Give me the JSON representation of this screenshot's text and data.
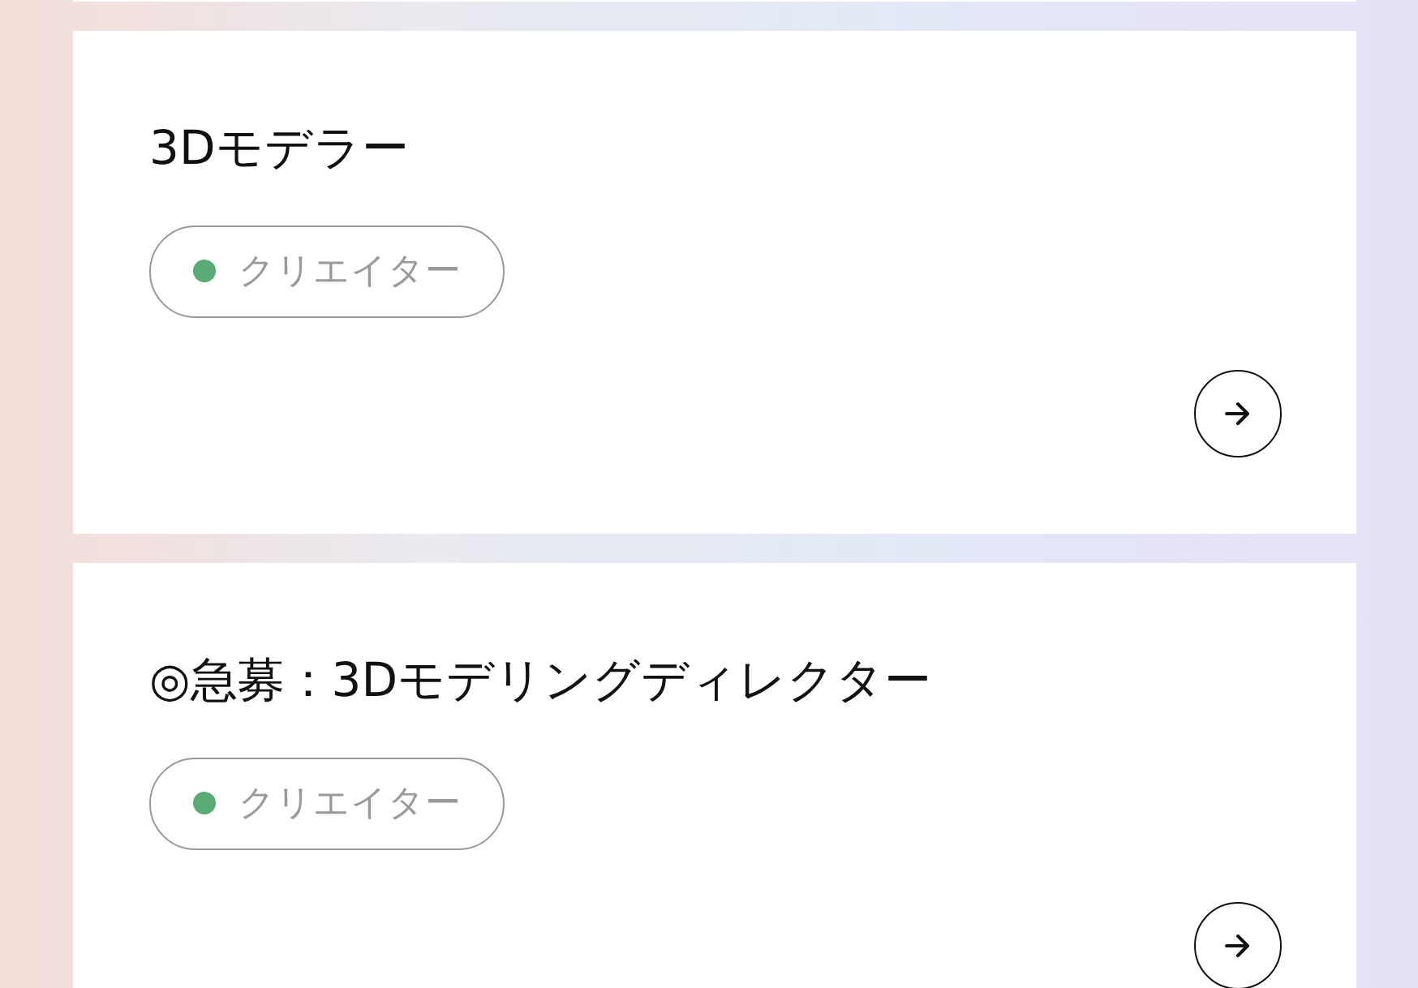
{
  "cards": [
    {
      "title": "3Dモデラー",
      "tag": {
        "label": "クリエイター",
        "color": "#5bab74"
      }
    },
    {
      "title": "◎急募：3Dモデリングディレクター",
      "tag": {
        "label": "クリエイター",
        "color": "#5bab74"
      }
    }
  ]
}
